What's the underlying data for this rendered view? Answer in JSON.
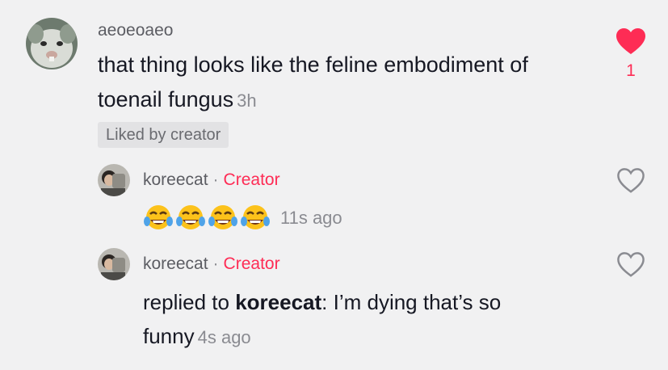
{
  "comment": {
    "username": "aeoeoaeo",
    "text_line1": "that thing looks like the feline embodiment of",
    "text_line2": "toenail fungus",
    "time": "3h",
    "badge": "Liked by creator",
    "like_count": "1",
    "liked": true
  },
  "replies": [
    {
      "username": "koreecat",
      "separator": "·",
      "tag": "Creator",
      "emoji_count": 4,
      "emoji_name": "face-with-tears-of-joy",
      "time": "11s ago"
    },
    {
      "username": "koreecat",
      "separator": "·",
      "tag": "Creator",
      "text_prefix": "replied to ",
      "mention": "koreecat",
      "text_after_mention": ": I’m dying that’s so",
      "text_line2": "funny",
      "time": "4s ago"
    }
  ],
  "colors": {
    "background": "#f1f1f2",
    "accent": "#fe2c55",
    "text": "#161823",
    "muted": "#8a8b91"
  }
}
